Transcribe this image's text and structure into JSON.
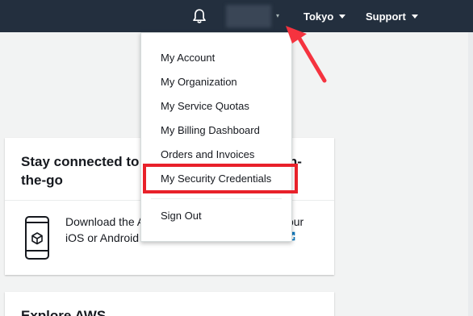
{
  "header": {
    "notifications_icon": "bell-icon",
    "region_label": "Tokyo",
    "support_label": "Support"
  },
  "account_dropdown": {
    "items": [
      {
        "label": "My Account"
      },
      {
        "label": "My Organization"
      },
      {
        "label": "My Service Quotas"
      },
      {
        "label": "My Billing Dashboard"
      },
      {
        "label": "Orders and Invoices"
      },
      {
        "label": "My Security Credentials",
        "highlighted": true
      },
      {
        "label": "Sign Out"
      }
    ]
  },
  "cards": {
    "stay_connected": {
      "title": "Stay connected to your AWS resources on-the-go",
      "body": "Download the AWS Console Mobile App to your iOS or Android mobile device.",
      "icon": "mobile-phone-icon",
      "link_icon": "external-link-icon"
    },
    "explore": {
      "title": "Explore AWS"
    }
  },
  "annotations": {
    "highlight_color": "#e8212a",
    "arrow_color": "#f5333f"
  },
  "colors": {
    "nav_background": "#232f3e",
    "page_background": "#f2f3f3",
    "link_blue": "#0073bb"
  }
}
